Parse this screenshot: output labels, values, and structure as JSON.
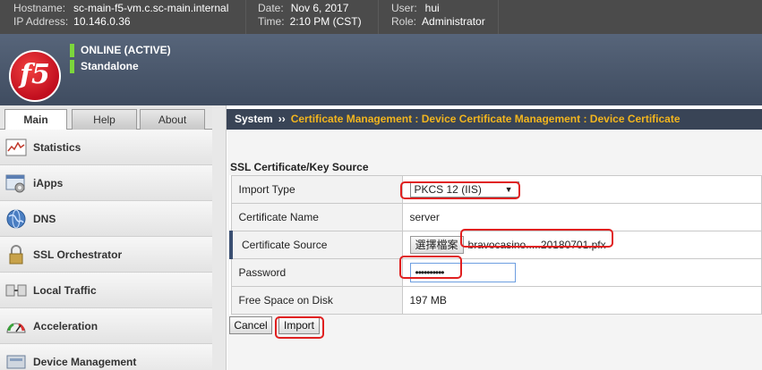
{
  "header": {
    "hostname_label": "Hostname:",
    "hostname": "sc-main-f5-vm.c.sc-main.internal",
    "ip_label": "IP Address:",
    "ip": "10.146.0.36",
    "date_label": "Date:",
    "date": "Nov 6, 2017",
    "time_label": "Time:",
    "time": "2:10 PM (CST)",
    "user_label": "User:",
    "user": "hui",
    "role_label": "Role:",
    "role": "Administrator"
  },
  "banner": {
    "logo_text": "f5",
    "status_line1": "ONLINE (ACTIVE)",
    "status_line2": "Standalone",
    "status_color": "#7cd63c"
  },
  "tabs": [
    {
      "label": "Main",
      "active": true
    },
    {
      "label": "Help",
      "active": false
    },
    {
      "label": "About",
      "active": false
    }
  ],
  "breadcrumb": {
    "root": "System",
    "separator": "››",
    "path": "Certificate Management : Device Certificate Management : Device Certificate"
  },
  "sidebar": {
    "items": [
      {
        "label": "Statistics",
        "icon": "statistics-icon"
      },
      {
        "label": "iApps",
        "icon": "iapps-icon"
      },
      {
        "label": "DNS",
        "icon": "dns-globe-icon"
      },
      {
        "label": "SSL Orchestrator",
        "icon": "ssl-lock-icon"
      },
      {
        "label": "Local Traffic",
        "icon": "local-traffic-icon"
      },
      {
        "label": "Acceleration",
        "icon": "acceleration-gauge-icon"
      },
      {
        "label": "Device Management",
        "icon": "device-management-icon"
      }
    ]
  },
  "form": {
    "section_title": "SSL Certificate/Key Source",
    "import_type_label": "Import Type",
    "import_type_value": "PKCS 12 (IIS)",
    "cert_name_label": "Certificate Name",
    "cert_name_value": "server",
    "cert_source_label": "Certificate Source",
    "choose_file_label": "選擇檔案",
    "file_name": "bravocasino.....20180701.pfx",
    "password_label": "Password",
    "password_value": "••••••••••",
    "free_space_label": "Free Space on Disk",
    "free_space_value": "197 MB"
  },
  "buttons": {
    "cancel": "Cancel",
    "import": "Import"
  },
  "colors": {
    "breadcrumb_bg": "#394456",
    "breadcrumb_path": "#f2b51e",
    "highlight": "#e02020"
  }
}
